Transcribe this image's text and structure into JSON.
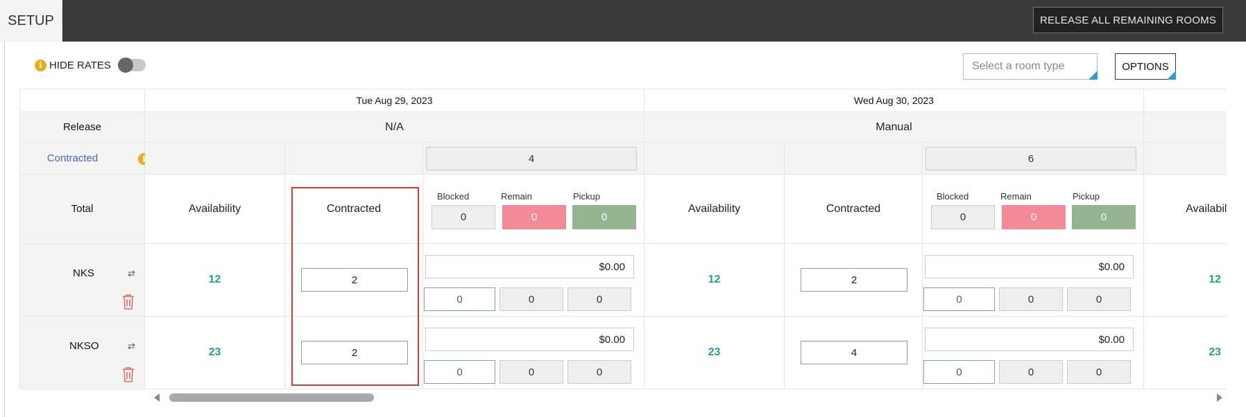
{
  "topbar": {
    "tab_label": "SETUP",
    "release_all_label": "RELEASE ALL REMAINING ROOMS"
  },
  "toolbar": {
    "hide_rates_label": "HIDE RATES",
    "info_glyph": "i",
    "room_type_placeholder": "Select a room type",
    "options_label": "OPTIONS"
  },
  "labels": {
    "release": "Release",
    "contracted": "Contracted",
    "total": "Total",
    "availability": "Availability",
    "contracted_col": "Contracted",
    "blocked": "Blocked",
    "remain": "Remain",
    "pickup": "Pickup"
  },
  "days": [
    {
      "header": "Tue   Aug 29, 2023",
      "release": "N/A",
      "contracted_total": "4",
      "blocked": "0",
      "remain": "0",
      "pickup": "0"
    },
    {
      "header": "Wed   Aug 30, 2023",
      "release": "Manual",
      "contracted_total": "6",
      "blocked": "0",
      "remain": "0",
      "pickup": "0"
    }
  ],
  "rooms": [
    {
      "code": "NKS",
      "day1": {
        "availability": "12",
        "contracted": "2",
        "rate": "$0.00",
        "a": "0",
        "b": "0",
        "c": "0"
      },
      "day2": {
        "availability": "12",
        "contracted": "2",
        "rate": "$0.00",
        "a": "0",
        "b": "0",
        "c": "0"
      },
      "day3_availability": "12"
    },
    {
      "code": "NKSO",
      "day1": {
        "availability": "23",
        "contracted": "2",
        "rate": "$0.00",
        "a": "0",
        "b": "0",
        "c": "0"
      },
      "day2": {
        "availability": "23",
        "contracted": "4",
        "rate": "$0.00",
        "a": "0",
        "b": "0",
        "c": "0"
      },
      "day3_availability": "23"
    }
  ],
  "partial_col_header": "Availabili",
  "colors": {
    "accent_blue": "#2a9fd6",
    "avail_green": "#27a083",
    "remain_pink": "#f28b97",
    "pickup_green": "#93b58f",
    "highlight_red": "#d9392f"
  }
}
